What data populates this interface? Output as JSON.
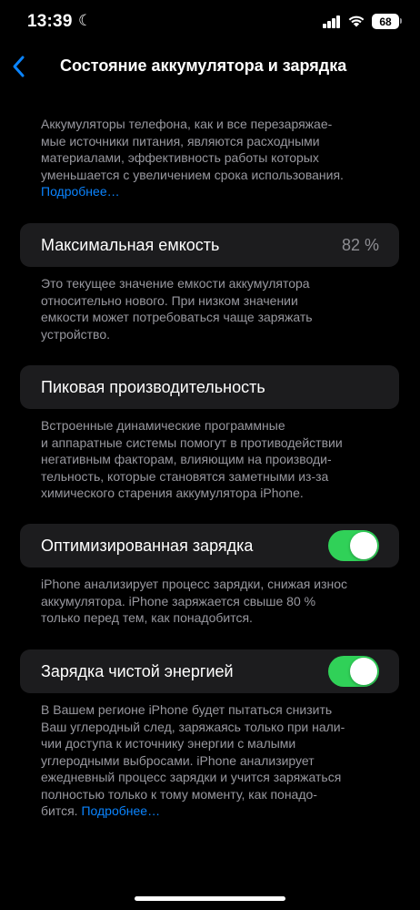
{
  "status_bar": {
    "time": "13:39",
    "battery_level": "68"
  },
  "nav": {
    "title": "Состояние аккумулятора и зарядка"
  },
  "intro": {
    "text": "Аккумуляторы телефона, как и все перезаряжае-\nмые источники питания, являются расходными\nматериалами, эффективность работы которых\nуменьшается с увеличением срока использования.",
    "link": "Подробнее…"
  },
  "max_capacity": {
    "label": "Максимальная емкость",
    "value": "82 %",
    "description": "Это текущее значение емкости аккумулятора\nотносительно нового. При низком значении\nемкости может потребоваться чаще заряжать\nустройство."
  },
  "peak_performance": {
    "label": "Пиковая производительность",
    "description": "Встроенные динамические программные\nи аппаратные системы помогут в противодействии\nнегативным факторам, влияющим на производи-\nтельность, которые становятся заметными из-за\nхимического старения аккумулятора iPhone."
  },
  "optimized_charging": {
    "label": "Оптимизированная зарядка",
    "enabled": true,
    "description": "iPhone анализирует процесс зарядки, снижая износ\nаккумулятора. iPhone заряжается свыше 80 %\nтолько перед тем, как понадобится."
  },
  "clean_energy": {
    "label": "Зарядка чистой энергией",
    "enabled": true,
    "description": "В Вашем регионе iPhone будет пытаться снизить\nВаш углеродный след, заряжаясь только при нали-\nчии доступа к источнику энергии с малыми\nуглеродными выбросами. iPhone анализирует\nежедневный процесс зарядки и учится заряжаться\nполностью только к тому моменту, как понадо-\nбится. ",
    "link": "Подробнее…"
  },
  "colors": {
    "background": "#000000",
    "cell": "#1c1c1e",
    "accent": "#0a84ff",
    "toggle_on": "#30d158",
    "secondary_text": "#98989f"
  }
}
